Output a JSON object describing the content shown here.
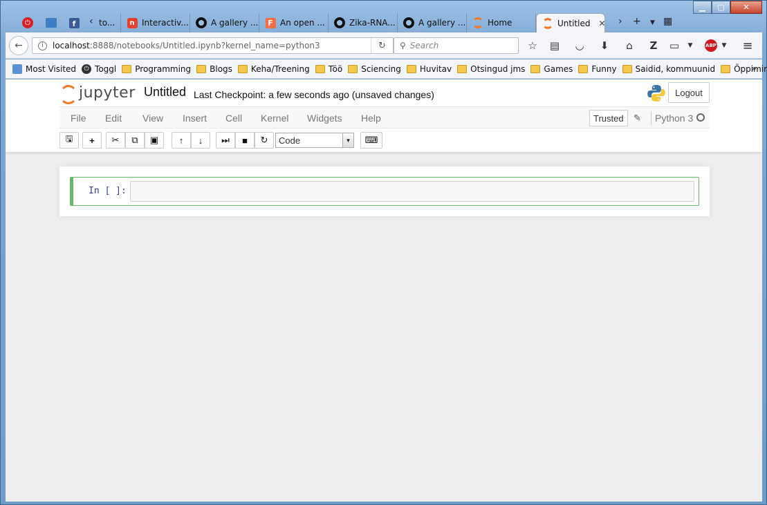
{
  "browser": {
    "tabs": [
      {
        "label": "to...",
        "icon": "page-icon"
      },
      {
        "label": "Interactiv...",
        "icon": "i-app-icon"
      },
      {
        "label": "A gallery ...",
        "icon": "github-icon"
      },
      {
        "label": "An open ...",
        "icon": "f-app-icon"
      },
      {
        "label": "Zika-RNA...",
        "icon": "github-icon"
      },
      {
        "label": "A gallery ...",
        "icon": "github-icon"
      },
      {
        "label": "Home",
        "icon": "jupyter-icon"
      },
      {
        "label": "Untitled",
        "icon": "jupyter-icon",
        "active": true
      }
    ],
    "url": {
      "host": "localhost",
      "rest": ":8888/notebooks/Untitled.ipynb?kernel_name=python3"
    },
    "search_placeholder": "Search",
    "bookmarks": [
      {
        "label": "Most Visited",
        "icon": "most-visited-icon"
      },
      {
        "label": "Toggl",
        "icon": "toggl-icon"
      },
      {
        "label": "Programming",
        "icon": "folder-icon"
      },
      {
        "label": "Blogs",
        "icon": "folder-icon"
      },
      {
        "label": "Keha/Treening",
        "icon": "folder-icon"
      },
      {
        "label": "Töö",
        "icon": "folder-icon"
      },
      {
        "label": "Sciencing",
        "icon": "folder-icon"
      },
      {
        "label": "Huvitav",
        "icon": "folder-icon"
      },
      {
        "label": "Otsingud jms",
        "icon": "folder-icon"
      },
      {
        "label": "Games",
        "icon": "folder-icon"
      },
      {
        "label": "Funny",
        "icon": "folder-icon"
      },
      {
        "label": "Saidid, kommuunid",
        "icon": "folder-icon"
      },
      {
        "label": "Õppimine",
        "icon": "folder-icon"
      }
    ],
    "abp_label": "ABP"
  },
  "jupyter": {
    "logo_text": "jupyter",
    "notebook_name": "Untitled",
    "checkpoint": "Last Checkpoint: a few seconds ago (unsaved changes)",
    "logout_label": "Logout",
    "menu": [
      "File",
      "Edit",
      "View",
      "Insert",
      "Cell",
      "Kernel",
      "Widgets",
      "Help"
    ],
    "trusted_label": "Trusted",
    "kernel_name": "Python 3",
    "cell_type": "Code",
    "cell_prompt": "In [ ]:",
    "accent_color": "#f37726",
    "selected_cell_color": "#66bb6a"
  }
}
